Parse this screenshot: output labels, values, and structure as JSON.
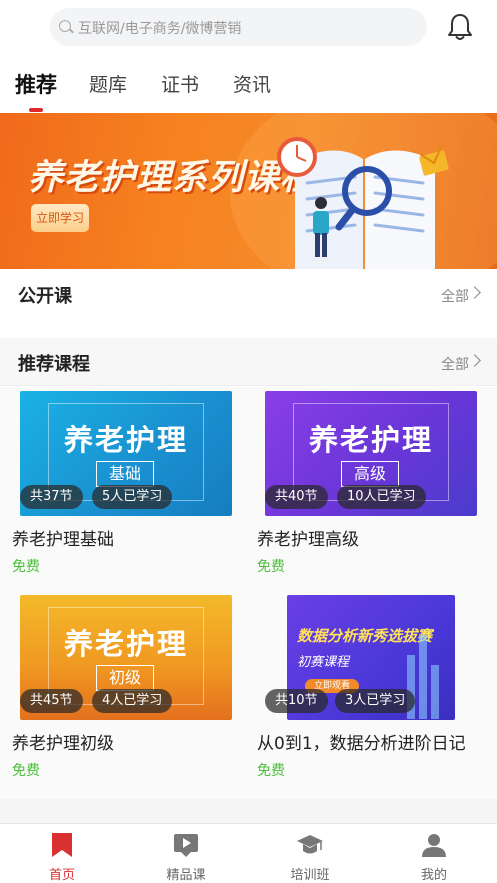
{
  "search": {
    "placeholder": "互联网/电子商务/微博营销"
  },
  "tabs": [
    {
      "label": "推荐",
      "active": true
    },
    {
      "label": "题库"
    },
    {
      "label": "证书"
    },
    {
      "label": "资讯"
    }
  ],
  "banner": {
    "title": "养老护理系列课程",
    "button": "立即学习"
  },
  "open_course": {
    "title": "公开课",
    "all": "全部"
  },
  "recommended": {
    "title": "推荐课程",
    "all": "全部",
    "courses": [
      {
        "thumb_title": "养老护理",
        "level": "基础",
        "lessons": "共37节",
        "learners": "5人已学习",
        "title": "养老护理基础",
        "price": "免费",
        "color": "#1aa0d8"
      },
      {
        "thumb_title": "养老护理",
        "level": "高级",
        "lessons": "共40节",
        "learners": "10人已学习",
        "title": "养老护理高级",
        "price": "免费",
        "color": "#6c3fd6"
      },
      {
        "thumb_title": "养老护理",
        "level": "初级",
        "lessons": "共45节",
        "learners": "4人已学习",
        "title": "养老护理初级",
        "price": "免费",
        "color": "#f0a020"
      },
      {
        "thumb_title": "数据分析新秀选拔赛",
        "subtitle": "初赛课程",
        "button": "立即观看",
        "lessons": "共10节",
        "learners": "3人已学习",
        "title": "从0到1，数据分析进阶日记",
        "price": "免费",
        "color": "#5a3de0"
      }
    ]
  },
  "nav": [
    {
      "label": "首页",
      "icon": "bookmark-icon",
      "active": true
    },
    {
      "label": "精品课",
      "icon": "video-icon"
    },
    {
      "label": "培训班",
      "icon": "graduation-cap-icon"
    },
    {
      "label": "我的",
      "icon": "user-icon"
    }
  ],
  "colors": {
    "accent": "#e02a2a",
    "free": "#4cbf3c"
  }
}
